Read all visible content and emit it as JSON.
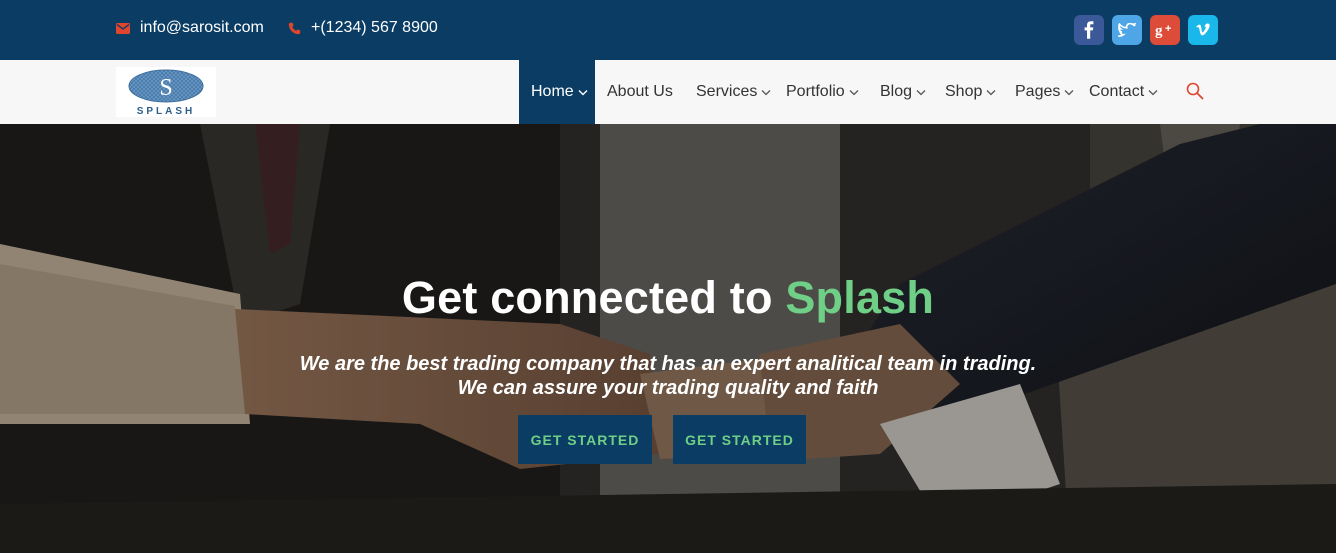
{
  "topbar": {
    "email": "info@sarosit.com",
    "phone": "+(1234) 567 8900",
    "social": [
      {
        "icon": "facebook-icon",
        "color": "#3b5998",
        "glyph": "f"
      },
      {
        "icon": "twitter-icon",
        "color": "#4ea6e6",
        "glyph": "t"
      },
      {
        "icon": "google-plus-icon",
        "color": "#dd4b39",
        "glyph": "g+"
      },
      {
        "icon": "vimeo-icon",
        "color": "#1ab7ea",
        "glyph": "v"
      }
    ]
  },
  "brand": {
    "logo_letter": "S",
    "logo_text": "SPLASH"
  },
  "nav": {
    "items": [
      {
        "label": "Home",
        "active": true
      },
      {
        "label": "About Us"
      },
      {
        "label": "Services"
      },
      {
        "label": "Portfolio"
      },
      {
        "label": "Blog"
      },
      {
        "label": "Shop"
      },
      {
        "label": "Pages"
      },
      {
        "label": "Contact"
      }
    ]
  },
  "hero": {
    "title_prefix": "Get connected to ",
    "title_accent": "Splash",
    "subtitle_line1": "We are the best trading company that has an expert analitical team in trading.",
    "subtitle_line2": "We can assure your trading quality and faith",
    "cta_primary": "GET STARTED",
    "cta_secondary": "GET STARTED"
  },
  "colors": {
    "brand_dark": "#0a3c64",
    "accent_green": "#6fcf86",
    "icon_red": "#e0452e"
  }
}
